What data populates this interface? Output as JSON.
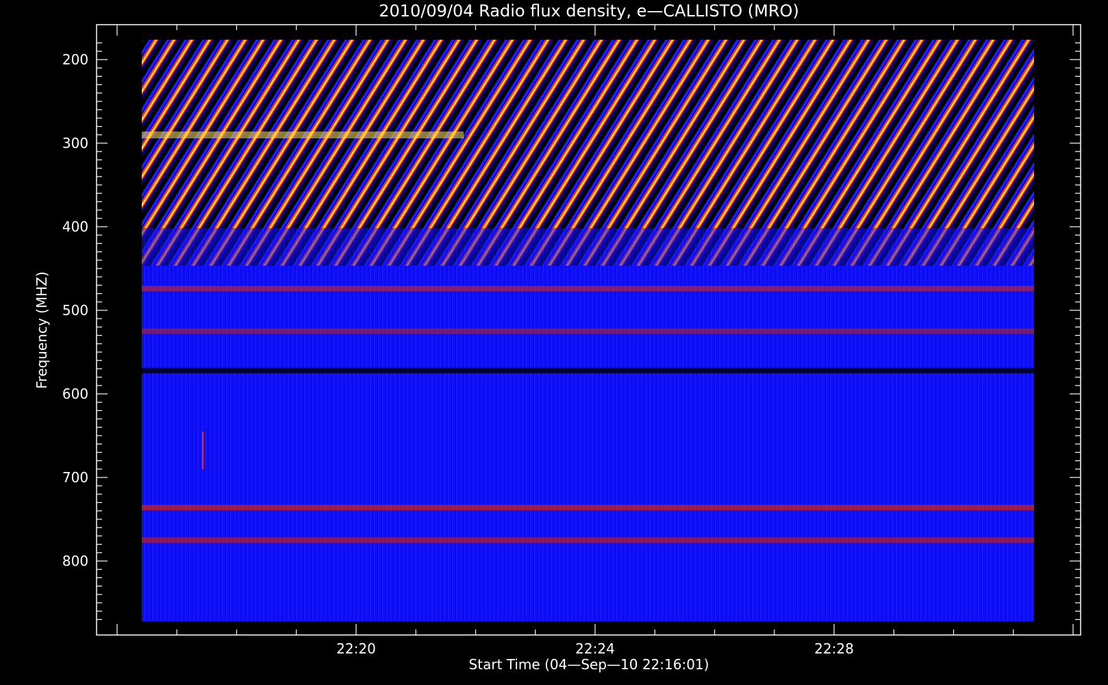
{
  "chart_data": {
    "type": "heatmap",
    "title": "2010/09/04  Radio flux density, e—CALLISTO (MRO)",
    "xlabel": "Start Time (04—Sep—10 22:16:01)",
    "ylabel": "Frequency (MHZ)",
    "x_ticks": [
      "22:20",
      "22:24",
      "22:28"
    ],
    "y_ticks": [
      "200",
      "300",
      "400",
      "500",
      "600",
      "700",
      "800"
    ],
    "x_range": [
      "22:16:01",
      "22:31:00"
    ],
    "ylim": [
      870,
      175
    ],
    "y_unit": "MHZ",
    "colormap": [
      "#000000",
      "#0000ff",
      "#8a1f55",
      "#ff2a00",
      "#ffe44a"
    ],
    "features": [
      {
        "kind": "drifting-stripes",
        "freq_range": [
          175,
          395
        ]
      },
      {
        "kind": "band",
        "freq": 474
      },
      {
        "kind": "band",
        "freq": 525
      },
      {
        "kind": "band",
        "freq": 572
      },
      {
        "kind": "band",
        "freq": 736
      },
      {
        "kind": "band",
        "freq": 775
      }
    ]
  }
}
